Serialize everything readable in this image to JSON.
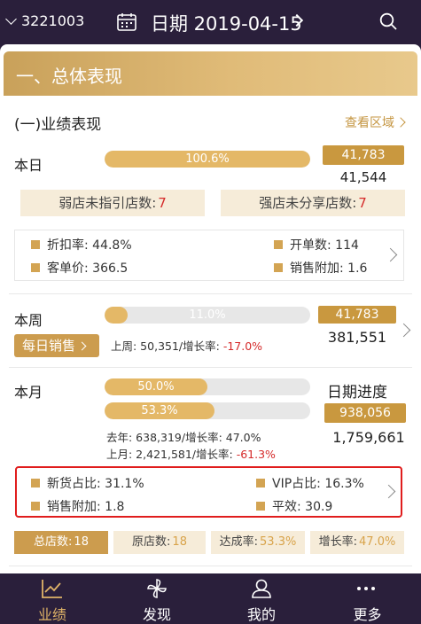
{
  "header": {
    "store_id": "3221003",
    "date_text": "日期 2019-04-15"
  },
  "banner": {
    "title": "一、总体表现"
  },
  "section": {
    "title": "(一)业绩表现",
    "view_area": "查看区域"
  },
  "today": {
    "label": "本日",
    "progress_text": "100.6%",
    "progress": 1.0,
    "target": "41,783",
    "actual": "41,544",
    "weak_label": "弱店未指引店数:",
    "weak_value": "7",
    "strong_label": "强店未分享店数:",
    "strong_value": "7",
    "metrics": {
      "discount": "折扣率: 44.8%",
      "orders": "开单数: 114",
      "avg_price": "客单价: 366.5",
      "sales_attach": "销售附加: 1.6"
    }
  },
  "week": {
    "label": "本周",
    "progress_text": "11.0%",
    "progress": 0.11,
    "target": "41,783",
    "actual": "381,551",
    "daily_btn": "每日销售",
    "prev_text": "上周: 50,351/增长率: ",
    "prev_growth": "-17.0%"
  },
  "month": {
    "label": "本月",
    "progress1_text": "50.0%",
    "progress1": 0.5,
    "progress2_text": "53.3%",
    "progress2": 0.533,
    "date_progress_label": "日期进度",
    "target": "938,056",
    "actual": "1,759,661",
    "last_year_text": "去年: 638,319/增长率: 47.0%",
    "last_month_text": "上月: 2,421,581/增长率: ",
    "last_month_growth": "-61.3%",
    "metrics": {
      "new_goods": "新货占比: 31.1%",
      "vip": "VIP占比: 16.3%",
      "sales_attach": "销售附加: 1.8",
      "efficiency": "平效: 30.9"
    }
  },
  "stats": [
    {
      "label": "总店数:",
      "value": "18"
    },
    {
      "label": "原店数:",
      "value": "18"
    },
    {
      "label": "达成率:",
      "value": "53.3%"
    },
    {
      "label": "增长率:",
      "value": "47.0%"
    }
  ],
  "tabs": [
    {
      "label": "业绩"
    },
    {
      "label": "发现"
    },
    {
      "label": "我的"
    },
    {
      "label": "更多"
    }
  ],
  "colors": {
    "gold": "#cc9c4e",
    "bar": "#e4b867",
    "negative": "#d52a2a",
    "nav_bg": "#2a1f3b"
  }
}
